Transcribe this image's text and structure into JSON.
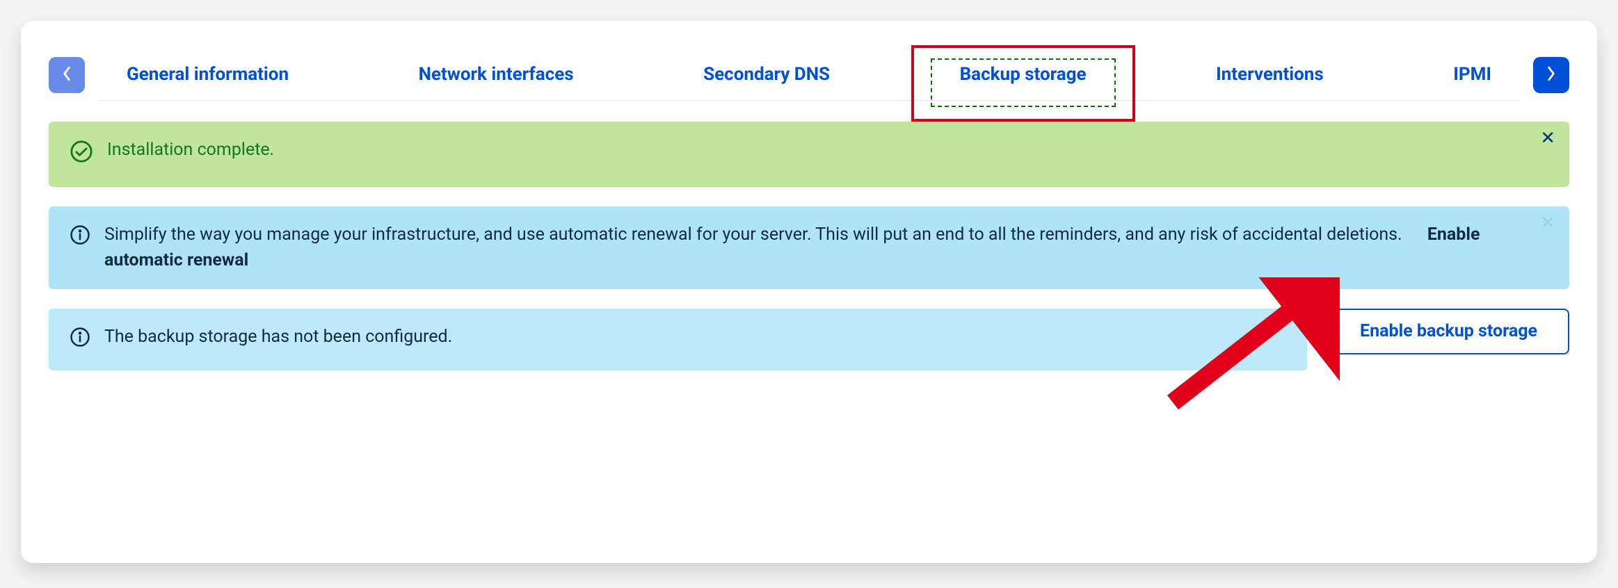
{
  "tabs": {
    "items": [
      {
        "label": "General information"
      },
      {
        "label": "Network interfaces"
      },
      {
        "label": "Secondary DNS"
      },
      {
        "label": "Backup storage"
      },
      {
        "label": "Interventions"
      },
      {
        "label": "IPMI"
      }
    ],
    "selected_index": 3
  },
  "alerts": {
    "success": {
      "text": "Installation complete."
    },
    "renewal": {
      "text": "Simplify the way you manage your infrastructure, and use automatic renewal for your server. This will put an end to all the reminders, and any risk of accidental deletions.",
      "link": "Enable automatic renewal"
    },
    "backup": {
      "text": "The backup storage has not been configured."
    }
  },
  "buttons": {
    "enable_backup": "Enable backup storage"
  }
}
